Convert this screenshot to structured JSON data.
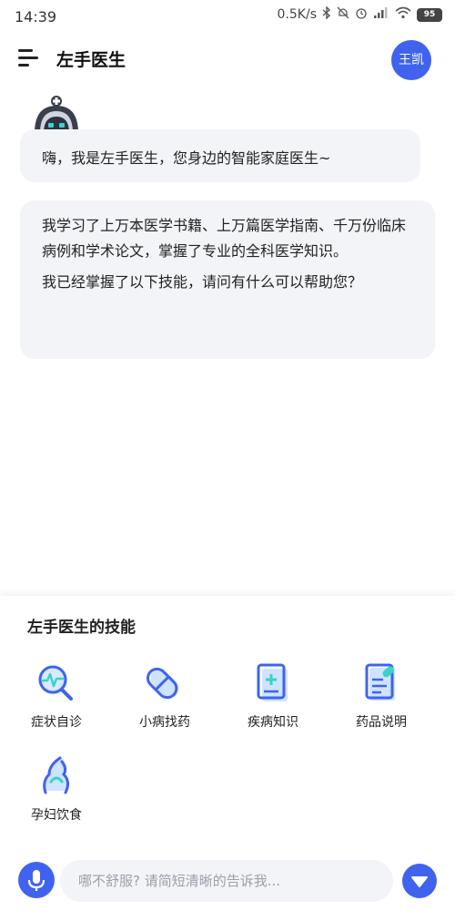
{
  "status_bar": {
    "time": "14:39",
    "network_speed": "0.5K/s",
    "battery": "95",
    "icons": [
      "bluetooth-icon",
      "mute-icon",
      "alarm-icon",
      "signal-icon",
      "wifi-icon",
      "battery-icon"
    ]
  },
  "header": {
    "title": "左手医生",
    "avatar_text": "王凯",
    "icons": [
      "menu-icon"
    ]
  },
  "chat": {
    "messages": [
      {
        "text": "嗨，我是左手医生，您身边的智能家庭医生~"
      },
      {
        "paragraphs": [
          "我学习了上万本医学书籍、上万篇医学指南、千万份临床病例和学术论文，掌握了专业的全科医学知识。",
          "我已经掌握了以下技能，请问有什么可以帮助您？"
        ]
      }
    ]
  },
  "skills": {
    "title": "左手医生的技能",
    "items": [
      {
        "label": "症状自诊",
        "icon": "symptom-search-icon"
      },
      {
        "label": "小病找药",
        "icon": "pill-icon"
      },
      {
        "label": "疾病知识",
        "icon": "disease-book-icon"
      },
      {
        "label": "药品说明",
        "icon": "drug-document-icon"
      },
      {
        "label": "孕妇饮食",
        "icon": "pregnancy-icon"
      }
    ]
  },
  "input_bar": {
    "placeholder": "哪不舒服? 请简短清晰的告诉我...",
    "value": "",
    "icons": [
      "microphone-icon",
      "chevron-down-icon"
    ]
  },
  "colors": {
    "accent": "#3f63ee",
    "bubble_bg": "#f3f4f7",
    "icon_light": "#cfe3ff"
  }
}
